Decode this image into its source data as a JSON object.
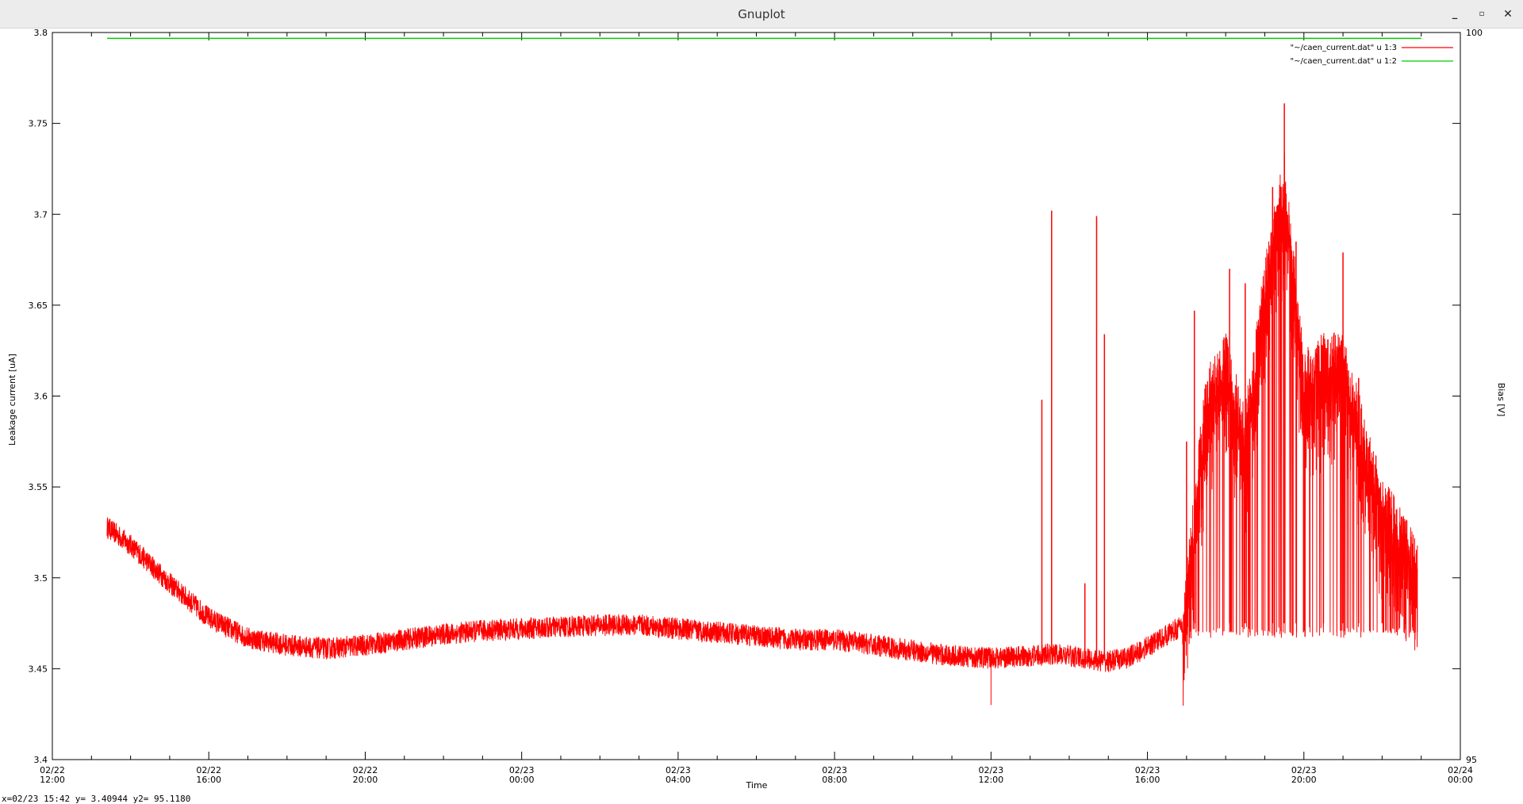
{
  "window": {
    "title": "Gnuplot",
    "controls": {
      "minimize": "_",
      "maximize": "▫",
      "close": "✕"
    }
  },
  "status": {
    "readout": "x=02/23 15:42 y= 3.40944 y2= 95.1180"
  },
  "chart_data": {
    "type": "line",
    "title": "",
    "xlabel": "Time",
    "ylabel": "Leakage current [uA]",
    "y2label": "Bias [V]",
    "x_range": [
      "02/22 12:00",
      "02/24 00:00"
    ],
    "ylim": [
      3.4,
      3.8
    ],
    "y2lim": [
      95,
      100
    ],
    "legend_position": "top-right",
    "grid": false,
    "x_ticks": [
      {
        "l1": "02/22",
        "l2": "12:00",
        "h": 0
      },
      {
        "l1": "02/22",
        "l2": "16:00",
        "h": 4
      },
      {
        "l1": "02/22",
        "l2": "20:00",
        "h": 8
      },
      {
        "l1": "02/23",
        "l2": "00:00",
        "h": 12
      },
      {
        "l1": "02/23",
        "l2": "04:00",
        "h": 16
      },
      {
        "l1": "02/23",
        "l2": "08:00",
        "h": 20
      },
      {
        "l1": "02/23",
        "l2": "12:00",
        "h": 24
      },
      {
        "l1": "02/23",
        "l2": "16:00",
        "h": 28
      },
      {
        "l1": "02/23",
        "l2": "20:00",
        "h": 32
      },
      {
        "l1": "02/24",
        "l2": "00:00",
        "h": 36
      }
    ],
    "y_ticks": [
      "3.4",
      "3.45",
      "3.5",
      "3.55",
      "3.6",
      "3.65",
      "3.7",
      "3.75",
      "3.8"
    ],
    "y_tick_values": [
      3.4,
      3.45,
      3.5,
      3.55,
      3.6,
      3.65,
      3.7,
      3.75,
      3.8
    ],
    "y2_ticks": [
      {
        "label": "95",
        "value": 95
      },
      {
        "label": "100",
        "value": 100
      }
    ],
    "series": [
      {
        "name": "\"~/caen_current.dat\" u 1:3",
        "axis": "y1",
        "color": "#ff0000",
        "x_hours": [
          1.4,
          2.0,
          3.0,
          4.0,
          5.0,
          6.0,
          7.0,
          8.0,
          9.0,
          10.0,
          11.0,
          12.0,
          13.0,
          14.0,
          15.0,
          16.0,
          17.0,
          18.0,
          19.0,
          20.0,
          21.0,
          22.0,
          23.0,
          24.0,
          25.0,
          25.6,
          26.0,
          26.6,
          27.0,
          27.5,
          28.0,
          28.6,
          29.0
        ],
        "values": [
          3.528,
          3.518,
          3.497,
          3.478,
          3.467,
          3.463,
          3.461,
          3.463,
          3.466,
          3.469,
          3.471,
          3.472,
          3.473,
          3.474,
          3.474,
          3.472,
          3.47,
          3.468,
          3.466,
          3.466,
          3.463,
          3.46,
          3.457,
          3.456,
          3.457,
          3.458,
          3.457,
          3.455,
          3.454,
          3.456,
          3.462,
          3.47,
          3.475
        ],
        "spikes": [
          {
            "x_hours": 25.3,
            "y": 3.598
          },
          {
            "x_hours": 25.55,
            "y": 3.702
          },
          {
            "x_hours": 26.4,
            "y": 3.497
          },
          {
            "x_hours": 26.7,
            "y": 3.699
          },
          {
            "x_hours": 26.9,
            "y": 3.634
          },
          {
            "x_hours": 29.0,
            "y": 3.575
          },
          {
            "x_hours": 29.2,
            "y": 3.647
          },
          {
            "x_hours": 30.1,
            "y": 3.67
          },
          {
            "x_hours": 30.5,
            "y": 3.662
          },
          {
            "x_hours": 31.2,
            "y": 3.715
          },
          {
            "x_hours": 31.5,
            "y": 3.761
          },
          {
            "x_hours": 31.8,
            "y": 3.685
          },
          {
            "x_hours": 32.5,
            "y": 3.632
          },
          {
            "x_hours": 33.0,
            "y": 3.679
          },
          {
            "x_hours": 33.4,
            "y": 3.61
          },
          {
            "x_hours": 34.0,
            "y": 3.535
          },
          {
            "x_hours": 34.8,
            "y": 3.51
          }
        ],
        "dip": {
          "x_hours": 24.0,
          "y": 3.43
        },
        "pulse_region_hours": [
          28.9,
          34.9
        ],
        "pulse_floor": 3.47,
        "pulse_upper_envelope": [
          {
            "x_hours": 28.9,
            "y": 3.47
          },
          {
            "x_hours": 29.5,
            "y": 3.6
          },
          {
            "x_hours": 30.0,
            "y": 3.62
          },
          {
            "x_hours": 30.5,
            "y": 3.58
          },
          {
            "x_hours": 31.0,
            "y": 3.66
          },
          {
            "x_hours": 31.5,
            "y": 3.72
          },
          {
            "x_hours": 32.0,
            "y": 3.61
          },
          {
            "x_hours": 32.5,
            "y": 3.62
          },
          {
            "x_hours": 33.0,
            "y": 3.62
          },
          {
            "x_hours": 33.5,
            "y": 3.58
          },
          {
            "x_hours": 34.0,
            "y": 3.54
          },
          {
            "x_hours": 34.5,
            "y": 3.525
          },
          {
            "x_hours": 34.9,
            "y": 3.505
          }
        ]
      },
      {
        "name": "\"~/caen_current.dat\" u 1:2",
        "axis": "y2",
        "color": "#00cc00",
        "x_hours": [
          1.4,
          35.0
        ],
        "values": [
          99.96,
          99.96
        ]
      }
    ]
  }
}
